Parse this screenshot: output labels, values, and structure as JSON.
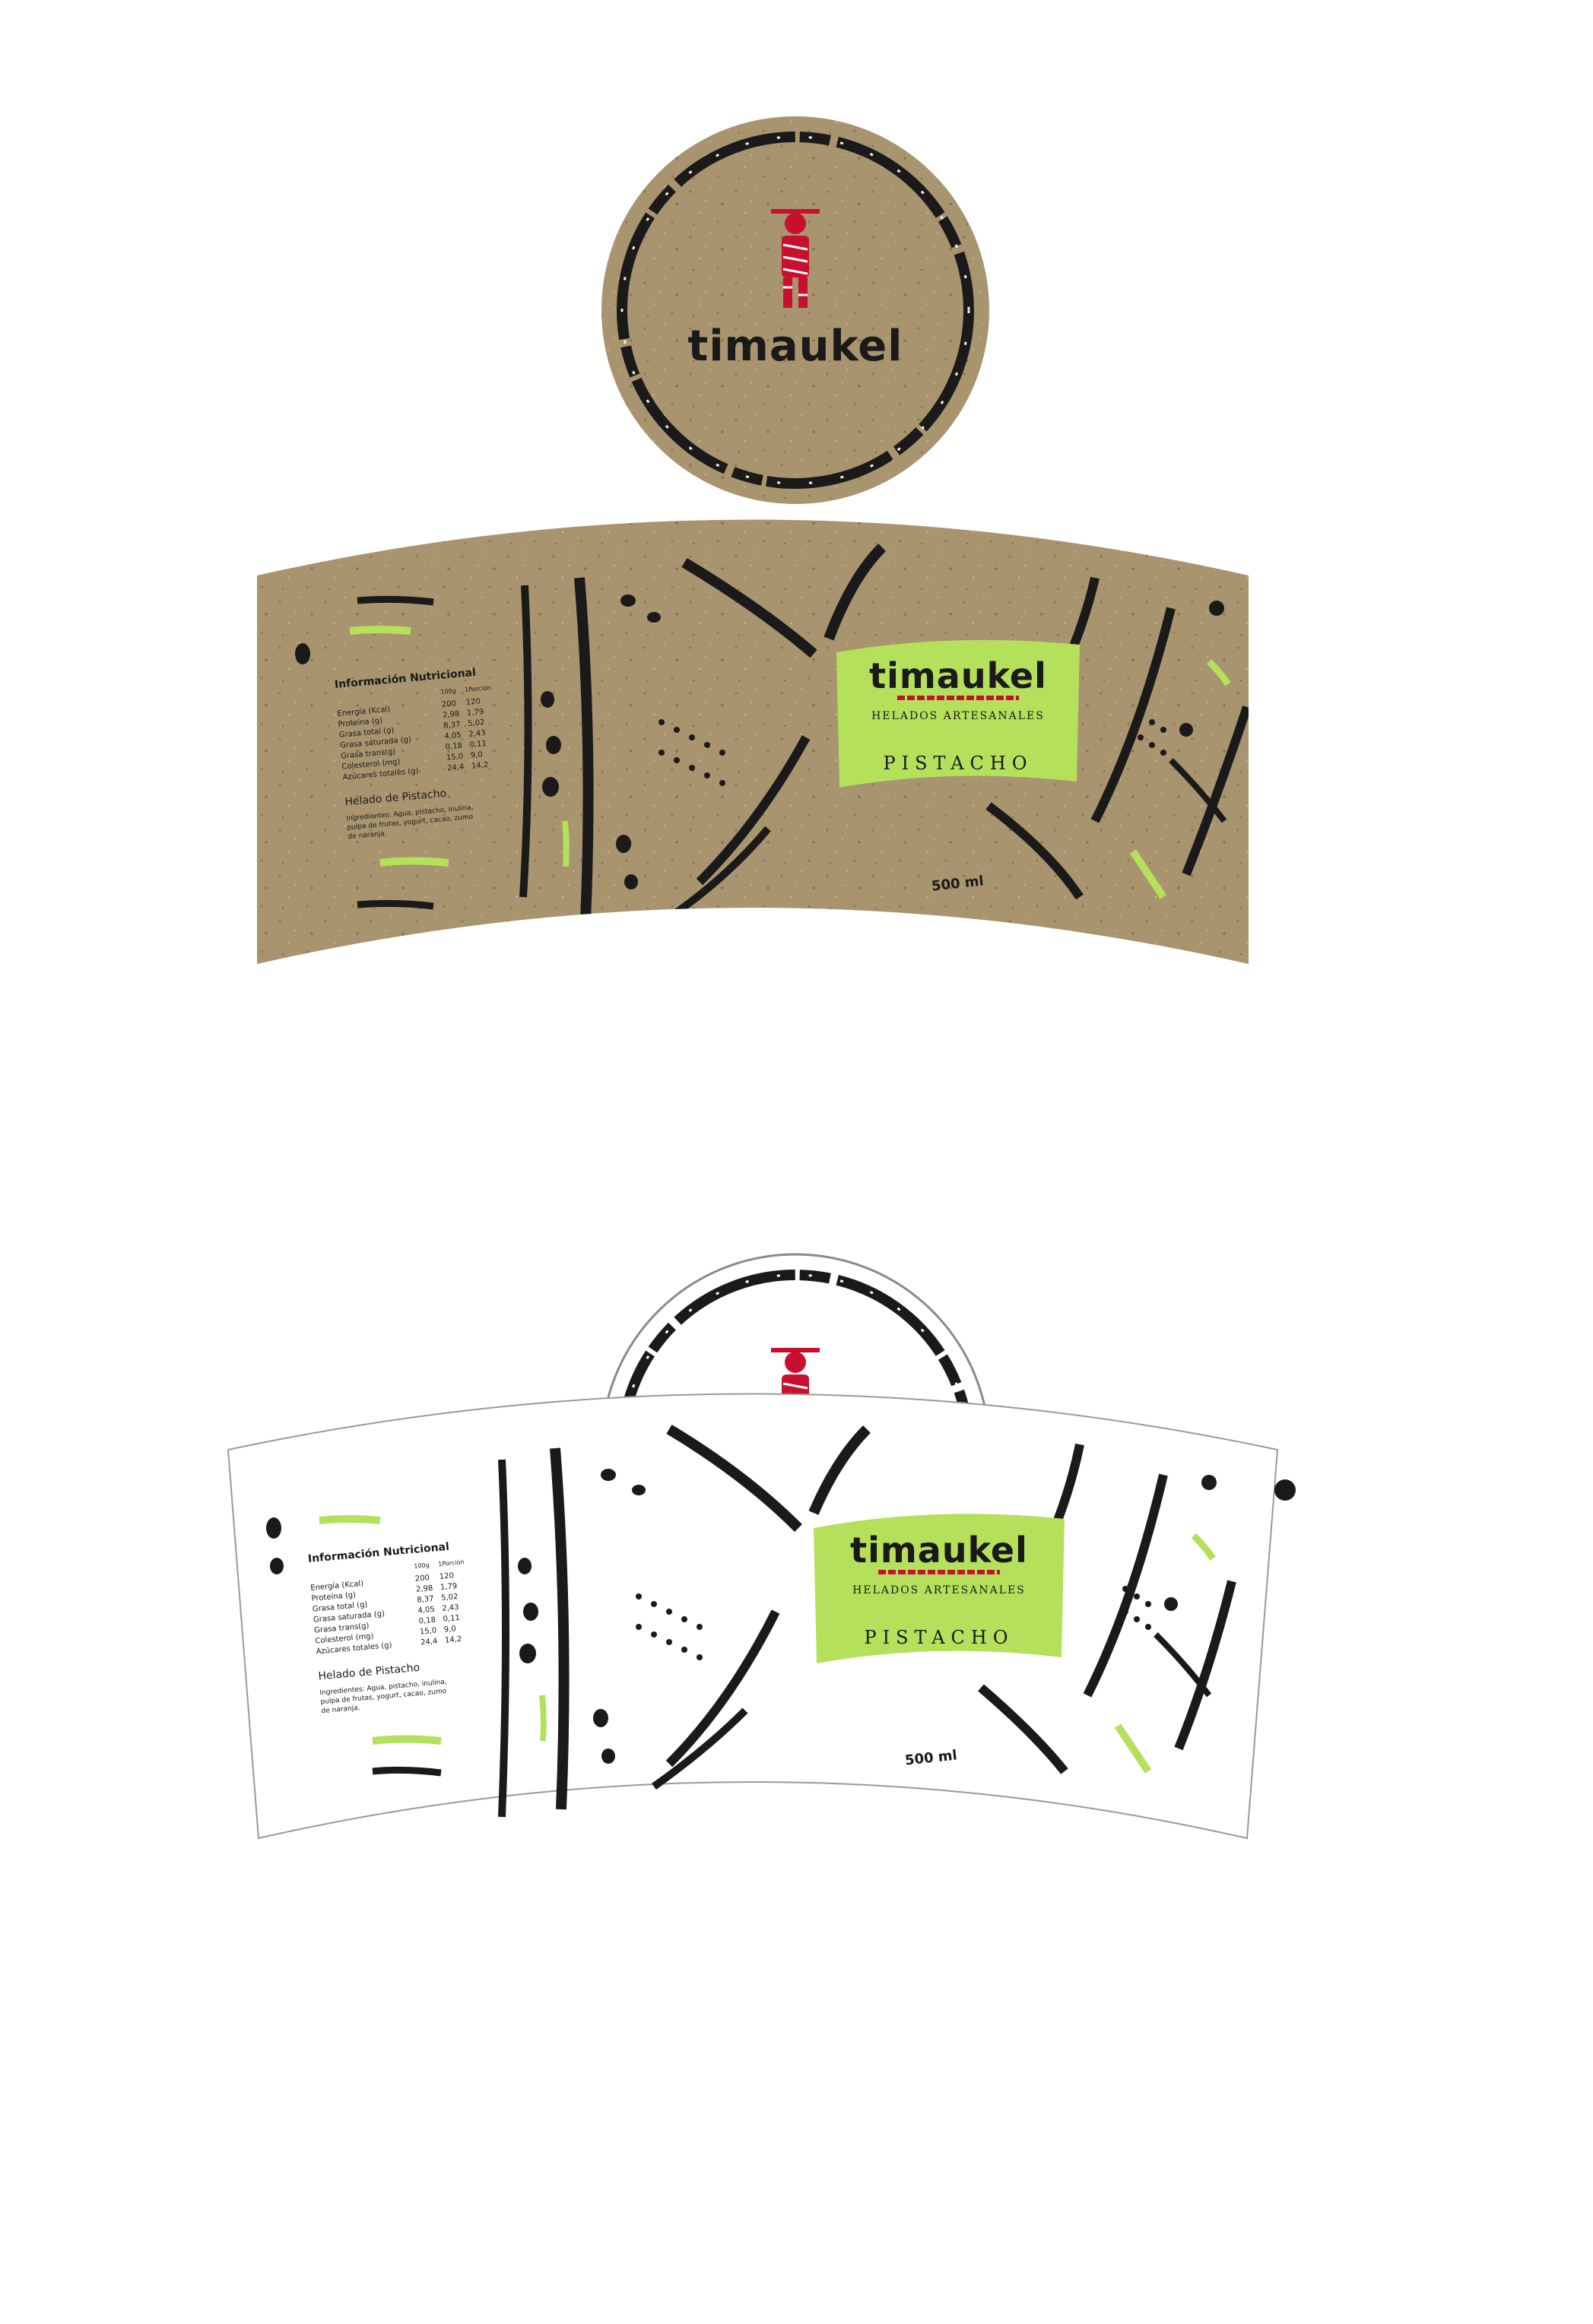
{
  "colors": {
    "kraft": "#a8946e",
    "kraft_dark": "#8f7c58",
    "ink": "#1a1a1a",
    "accent_green": "#b4e05c",
    "brand_red": "#c8102e",
    "white": "#ffffff",
    "outline": "#9a9a9a"
  },
  "brand": {
    "name": "timaukel",
    "subtitle": "HELADOS ARTESANALES",
    "flavor": "PISTACHO",
    "volume": "500 ml"
  },
  "nutrition": {
    "title": "Información Nutricional",
    "col_100g": "100g",
    "col_portion": "1Porción",
    "rows": [
      {
        "label": "Energía (Kcal)",
        "v100": "200",
        "vport": "120"
      },
      {
        "label": "Proteína (g)",
        "v100": "2,98",
        "vport": "1,79"
      },
      {
        "label": "Grasa total (g)",
        "v100": "8,37",
        "vport": "5,02"
      },
      {
        "label": "Grasa saturada (g)",
        "v100": "4,05",
        "vport": "2,43"
      },
      {
        "label": "Grasa trans(g)",
        "v100": "0,18",
        "vport": "0,11"
      },
      {
        "label": "Colesterol (mg)",
        "v100": "15,0",
        "vport": "9,0"
      },
      {
        "label": "Azúcares totales (g)",
        "v100": "24,4",
        "vport": "14,2"
      }
    ],
    "product_name": "Helado de Pistacho",
    "ingredients": [
      "Ingredientes: Agua, pistacho, inulina,",
      "pulpa de frutas, yogurt, cacao, zumo",
      "de naranja."
    ]
  },
  "icons": {
    "mascot": "red-figure-mascot-icon",
    "dots": "dot-pattern-icon",
    "strokes": "brush-stroke-icon"
  }
}
